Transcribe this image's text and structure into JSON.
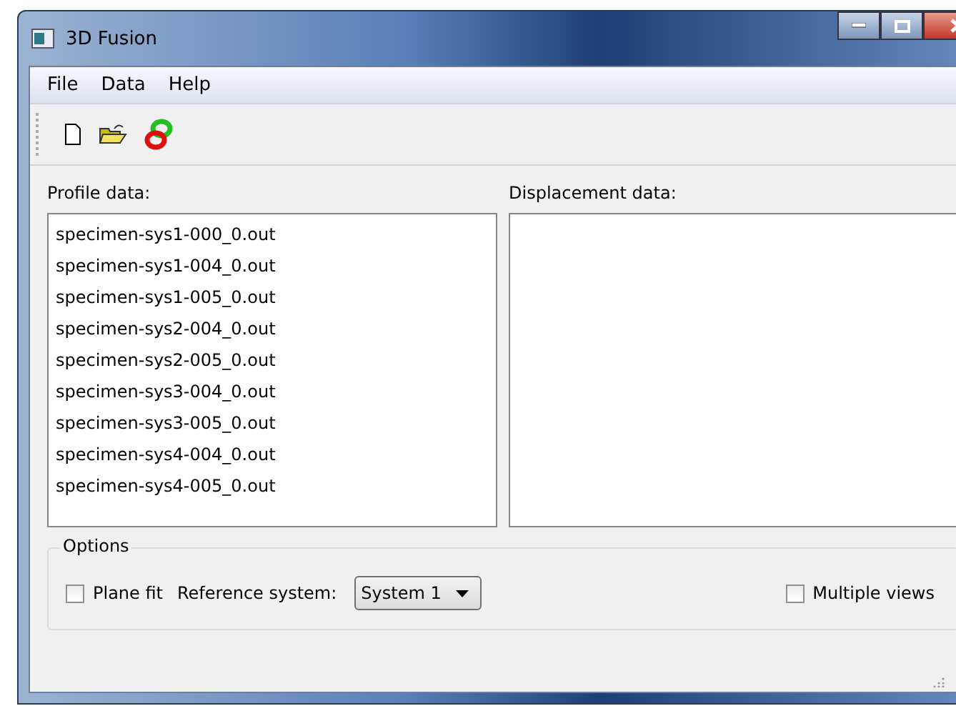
{
  "window": {
    "title": "3D Fusion"
  },
  "menu": [
    "File",
    "Data",
    "Help"
  ],
  "toolbar": [
    {
      "kind": "new"
    },
    {
      "kind": "open"
    },
    {
      "kind": "link"
    }
  ],
  "profile": {
    "label": "Profile data:",
    "items": [
      "specimen-sys1-000_0.out",
      "specimen-sys1-004_0.out",
      "specimen-sys1-005_0.out",
      "specimen-sys2-004_0.out",
      "specimen-sys2-005_0.out",
      "specimen-sys3-004_0.out",
      "specimen-sys3-005_0.out",
      "specimen-sys4-004_0.out",
      "specimen-sys4-005_0.out"
    ]
  },
  "displacement": {
    "label": "Displacement data:"
  },
  "options": {
    "title": "Options",
    "plane_fit": {
      "label": "Plane fit",
      "checked": false
    },
    "reference_label": "Reference system:",
    "reference_value": "System 1",
    "multiple_views": {
      "label": "Multiple views",
      "checked": false
    }
  }
}
